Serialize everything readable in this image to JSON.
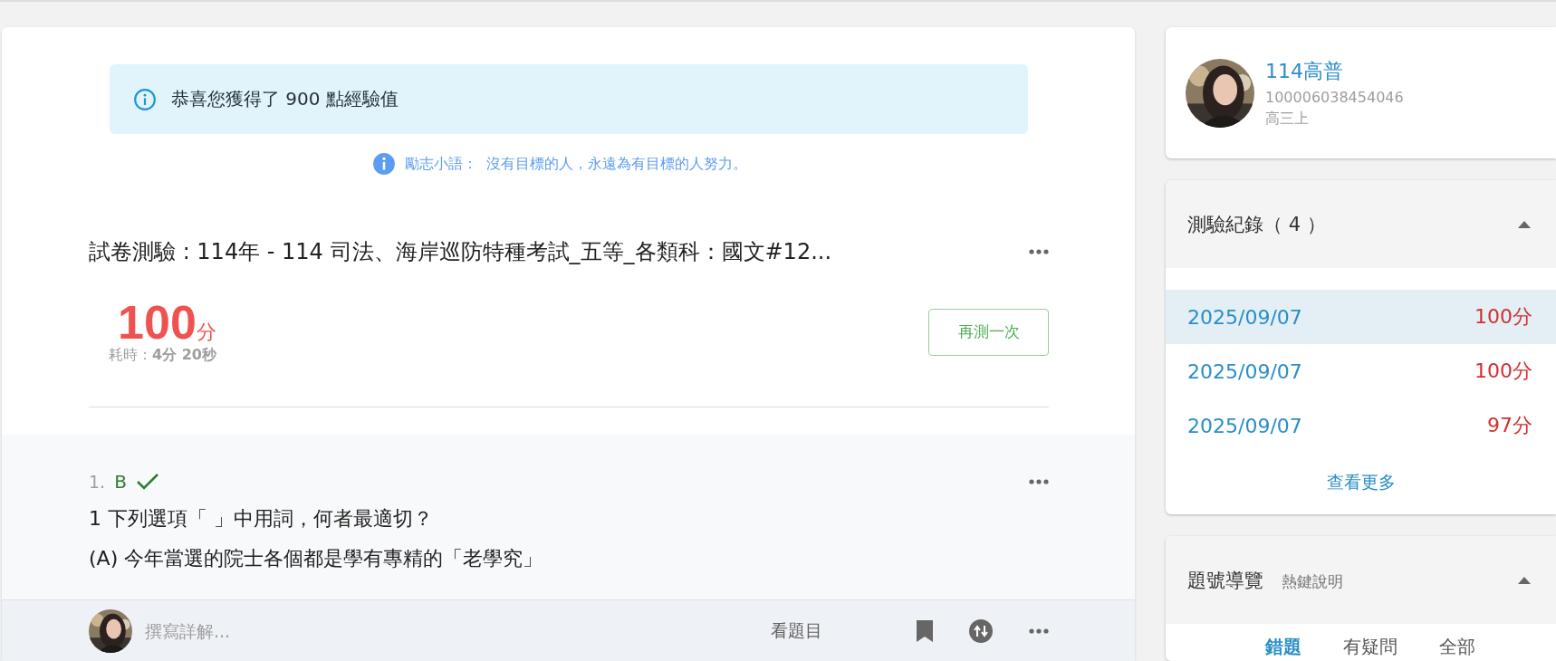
{
  "notice": {
    "text": "恭喜您獲得了 900 點經驗值"
  },
  "motto": {
    "label": "勵志小語：",
    "text": "沒有目標的人，永遠為有目標的人努力。"
  },
  "exam": {
    "title": "試卷測驗 : 114年 - 114 司法、海岸巡防特種考試_五等_各類科：國文#12...",
    "score": "100",
    "score_unit": "分",
    "time_label": "耗時：",
    "time": "4分 20秒",
    "retry_button": "再測一次"
  },
  "question": {
    "number": "1.",
    "answer": "B",
    "correct": true,
    "text": "1 下列選項「 」中用詞，何者最適切？",
    "option": "(A) 今年當選的院士各個都是學有專精的「老學究」"
  },
  "comment_bar": {
    "placeholder": "撰寫詳解...",
    "view_question": "看題目"
  },
  "profile": {
    "name": "114高普",
    "id": "100006038454046",
    "grade": "高三上"
  },
  "records": {
    "title": "測驗紀錄（ 4 ）",
    "expanded": true,
    "items": [
      {
        "date": "2025/09/07",
        "score": "100分",
        "selected": true
      },
      {
        "date": "2025/09/07",
        "score": "100分",
        "selected": false
      },
      {
        "date": "2025/09/07",
        "score": "97分",
        "selected": false
      }
    ],
    "more": "查看更多"
  },
  "navigator": {
    "title": "題號導覽",
    "hotkeys": "熱鍵說明",
    "expanded": true,
    "tabs": [
      {
        "label": "錯題",
        "selected": true
      },
      {
        "label": "有疑問",
        "selected": false
      },
      {
        "label": "全部",
        "selected": false
      }
    ]
  }
}
